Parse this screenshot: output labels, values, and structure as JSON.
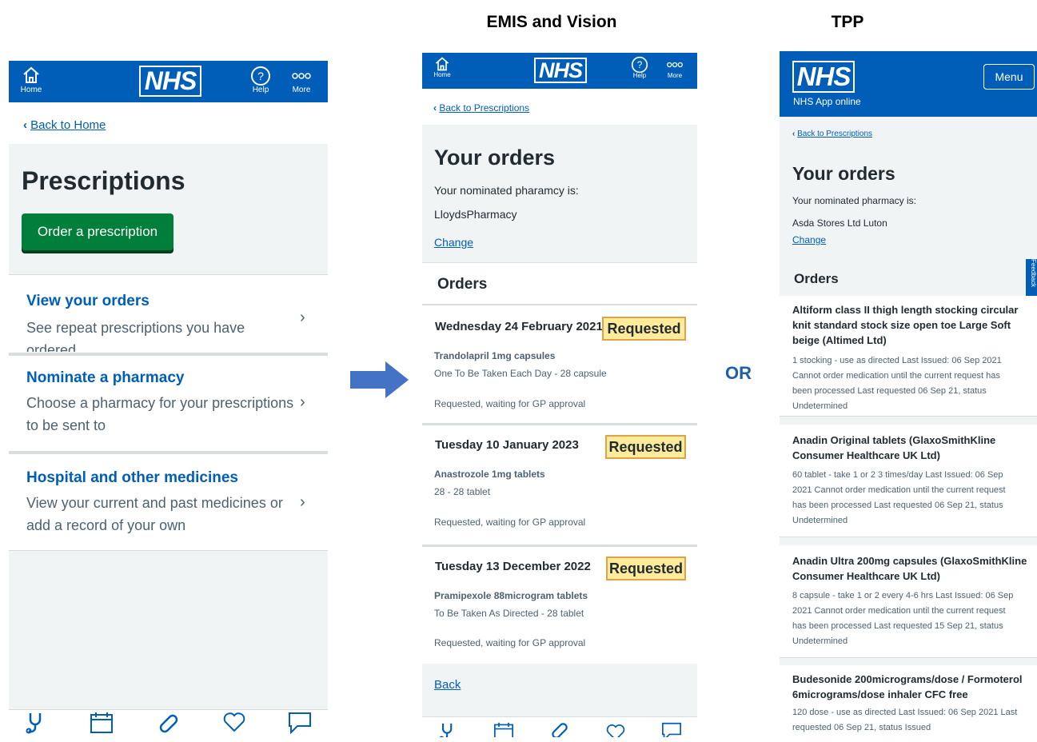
{
  "headings": {
    "middle": "EMIS and Vision",
    "right": "TPP",
    "or": "OR"
  },
  "colors": {
    "nhs_blue": "#005eb8",
    "green_button": "#007f3b",
    "badge_yellow": "#ffeb99",
    "grey_bg": "#f0f4f5"
  },
  "app_header": {
    "logo": "NHS",
    "home_label": "Home",
    "help_label": "Help",
    "more_label": "More",
    "home_icon": "home-icon",
    "help_icon": "help-icon",
    "more_icon": "more-dots-icon"
  },
  "panel1": {
    "back_link": "Back to Home",
    "page_title": "Prescriptions",
    "order_button": "Order a prescription",
    "items": [
      {
        "title": "View your orders",
        "desc": "See repeat prescriptions you have ordered"
      },
      {
        "title": "Nominate a pharmacy",
        "desc": "Choose a pharmacy for your prescriptions to be sent to"
      },
      {
        "title": "Hospital and other medicines",
        "desc": "View your current and past medicines or add a record of your own"
      }
    ]
  },
  "panel2": {
    "back_link": "Back to Prescriptions",
    "page_title": "Your orders",
    "pharmacy_label": "Your nominated pharamcy is:",
    "pharmacy_name": "LloydsPharmacy",
    "change_link": "Change",
    "orders_heading": "Orders",
    "orders": [
      {
        "date": "Wednesday 24 February 2021",
        "badge": "Requested",
        "medicine": "Trandolapril 1mg capsules",
        "dosage": "One To Be Taken Each Day - 28 capsule",
        "status": "Requested, waiting for GP approval"
      },
      {
        "date": "Tuesday 10 January 2023",
        "badge": "Requested",
        "medicine": "Anastrozole 1mg tablets",
        "dosage": "28 - 28 tablet",
        "status": "Requested, waiting for GP approval"
      },
      {
        "date": "Tuesday 13 December 2022",
        "badge": "Requested",
        "medicine": "Pramipexole 88microgram tablets",
        "dosage": "To Be Taken As Directed - 28 tablet",
        "status": "Requested, waiting for GP approval"
      }
    ],
    "back_bottom": "Back"
  },
  "tab_bar": [
    "stethoscope-icon",
    "calendar-icon",
    "pill-icon",
    "heart-icon",
    "message-icon"
  ],
  "panel3": {
    "logo": "NHS",
    "site_name": "NHS App online",
    "menu_button": "Menu",
    "back_link": "Back to Prescriptions",
    "page_title": "Your orders",
    "pharmacy_label": "Your nominated pharmacy is:",
    "pharmacy_name": "Asda Stores Ltd Luton",
    "change_link": "Change",
    "orders_heading": "Orders",
    "feedback_tab": "Feedback",
    "orders": [
      {
        "title": [
          "Altiform class II thigh length stocking circular",
          "knit standard stock size open toe Large Soft",
          "beige (Altimed Ltd)"
        ],
        "body": [
          "1 stocking - use as directed Last Issued: 06 Sep 2021",
          "Cannot order medication until the current request has",
          "been processed Last requested 06 Sep 21, status",
          "Undetermined"
        ]
      },
      {
        "title": [
          "Anadin Original tablets (GlaxoSmithKline",
          "Consumer Healthcare UK Ltd)"
        ],
        "body": [
          "60 tablet - take 1 or 2 3 times/day Last Issued: 06 Sep",
          "2021 Cannot order medication until the current request",
          "has been processed Last requested 06 Sep 21, status",
          "Undetermined"
        ]
      },
      {
        "title": [
          "Anadin Ultra 200mg capsules (GlaxoSmithKline",
          "Consumer Healthcare UK Ltd)"
        ],
        "body": [
          "8 capsule - take 1 or 2 every 4-6 hrs Last Issued: 06 Sep",
          "2021 Cannot order medication until the current request",
          "has been processed Last requested 15 Sep 21, status",
          "Undetermined"
        ]
      },
      {
        "title": [
          "Budesonide 200micrograms/dose / Formoterol",
          "6micrograms/dose inhaler CFC free"
        ],
        "body": [
          "120 dose - use as directed Last Issued: 06 Sep 2021 Last",
          "requested 06 Sep 21, status Issued"
        ]
      }
    ]
  }
}
